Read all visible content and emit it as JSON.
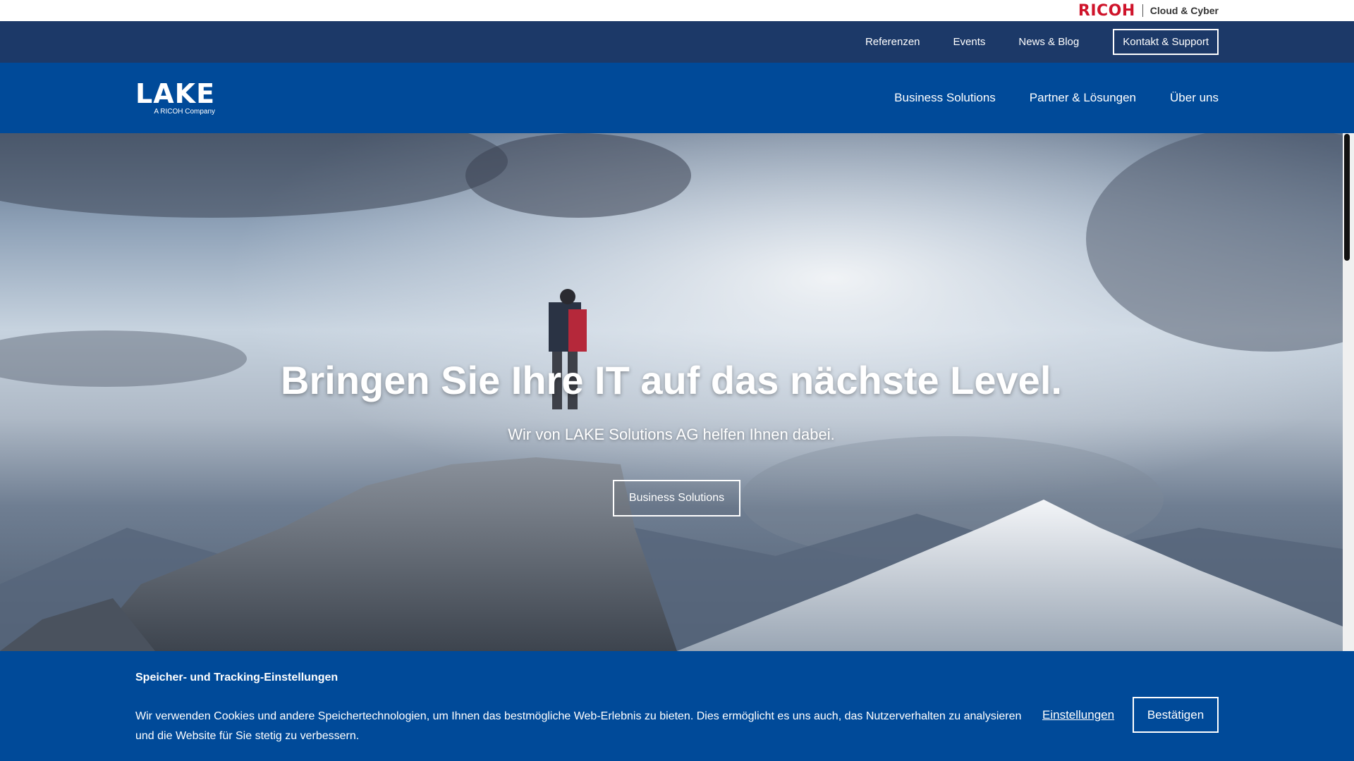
{
  "brand_bar": {
    "logo": "RICOH",
    "tagline": "Cloud & Cyber"
  },
  "utility_nav": {
    "links": [
      "Referenzen",
      "Events",
      "News & Blog"
    ],
    "contact_button": "Kontakt & Support"
  },
  "main_nav": {
    "logo_text": "LAKE",
    "logo_sub": "A RICOH Company",
    "items": [
      "Business Solutions",
      "Partner & Lösungen",
      "Über uns"
    ]
  },
  "hero": {
    "title": "Bringen Sie Ihre IT auf das nächste Level.",
    "subtitle": "Wir von LAKE Solutions AG helfen Ihnen dabei.",
    "cta": "Business Solutions"
  },
  "cookie_banner": {
    "title": "Speicher- und Tracking-Einstellungen",
    "text": "Wir verwenden Cookies und andere Speichertechnologien, um Ihnen das bestmögliche Web-Erlebnis zu bieten. Dies ermöglicht es uns auch, das Nutzerverhalten zu analysieren und die Website für Sie stetig zu verbessern.",
    "settings_link": "Einstellungen",
    "confirm_button": "Bestätigen"
  },
  "colors": {
    "ricoh_red": "#cf142b",
    "utility_bar": "#1c3968",
    "primary_blue": "#004a99"
  }
}
